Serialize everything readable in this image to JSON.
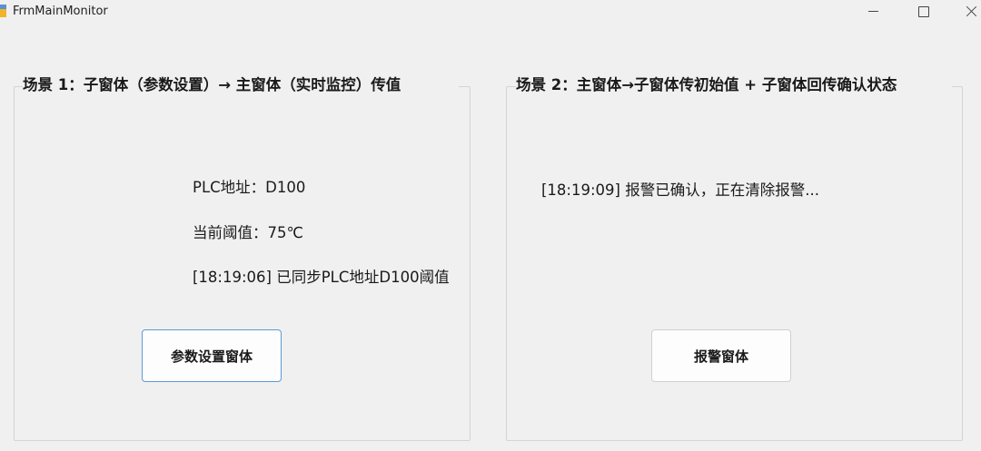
{
  "window": {
    "title": "FrmMainMonitor"
  },
  "scene1": {
    "title": "场景 1：子窗体（参数设置）→ 主窗体（实时监控）传值",
    "plc_address": "PLC地址：D100",
    "threshold": "当前阈值：75℃",
    "log": "[18:19:06] 已同步PLC地址D100阈值",
    "button_label": "参数设置窗体"
  },
  "scene2": {
    "title": "场景 2：主窗体→子窗体传初始值 + 子窗体回传确认状态",
    "log": "[18:19:09] 报警已确认，正在清除报警...",
    "button_label": "报警窗体"
  },
  "icons": {
    "app": "app-form-icon",
    "minimize": "minimize-icon",
    "maximize": "maximize-icon",
    "close": "close-icon"
  }
}
